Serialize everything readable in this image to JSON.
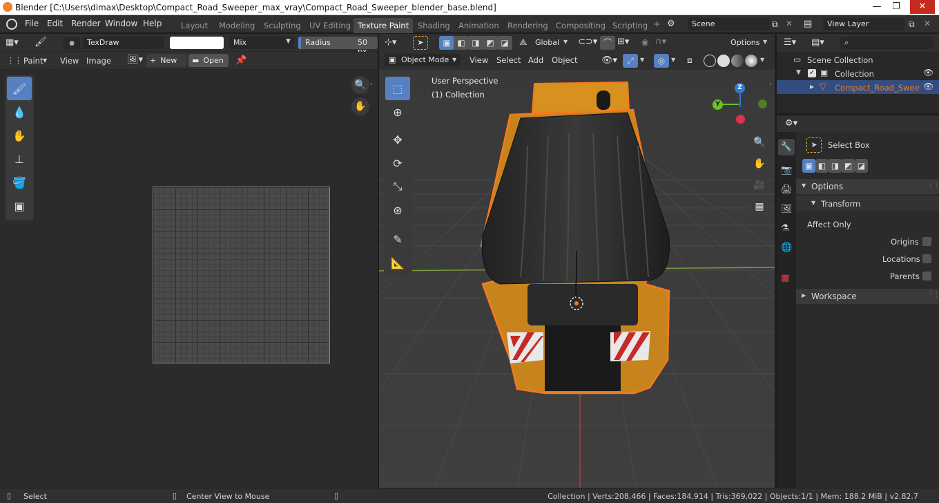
{
  "window": {
    "title": "Blender [C:\\Users\\dimax\\Desktop\\Compact_Road_Sweeper_max_vray\\Compact_Road_Sweeper_blender_base.blend]",
    "minimize": "—",
    "maximize": "❐",
    "close": "✕"
  },
  "menu": [
    "File",
    "Edit",
    "Render",
    "Window",
    "Help"
  ],
  "workspaces": [
    "Layout",
    "Modeling",
    "Sculpting",
    "UV Editing",
    "Texture Paint",
    "Shading",
    "Animation",
    "Rendering",
    "Compositing",
    "Scripting"
  ],
  "workspace_add": "+",
  "scene": {
    "label": "Scene",
    "view_layer": "View Layer"
  },
  "image_editor": {
    "brush_name": "TexDraw",
    "blend_mode": "Mix",
    "radius_label": "Radius",
    "radius_value": "50 px",
    "mode": "Paint",
    "view": "View",
    "image": "Image",
    "new_label": "New",
    "open_label": "Open"
  },
  "viewport": {
    "mode": "Object Mode",
    "menus": [
      "View",
      "Select",
      "Add",
      "Object"
    ],
    "transform": "Global",
    "options": "Options",
    "perspective": "User Perspective",
    "collection": "(1) Collection",
    "gizmo": {
      "z": "Z",
      "y": "Y"
    }
  },
  "outliner": {
    "scene_collection": "Scene Collection",
    "collection": "Collection",
    "object": "Compact_Road_Sweeper"
  },
  "properties": {
    "tool_name": "Select Box",
    "options": "Options",
    "transform": "Transform",
    "affect_only": "Affect Only",
    "origins": "Origins",
    "locations": "Locations",
    "parents": "Parents",
    "workspace": "Workspace"
  },
  "status": {
    "select": "Select",
    "center": "Center View to Mouse",
    "stats": "Collection | Verts:208,466 | Faces:184,914 | Tris:369,022 | Objects:1/1 | Mem: 188.2 MiB | v2.82.7"
  },
  "colors": {
    "accent": "#5680c2",
    "selection_outline": "#f47a20",
    "sweeper_body": "#d8901e",
    "gizmo_z": "#2e7bd6",
    "gizmo_y": "#6fbf2a",
    "gizmo_x": "#e0324a"
  }
}
